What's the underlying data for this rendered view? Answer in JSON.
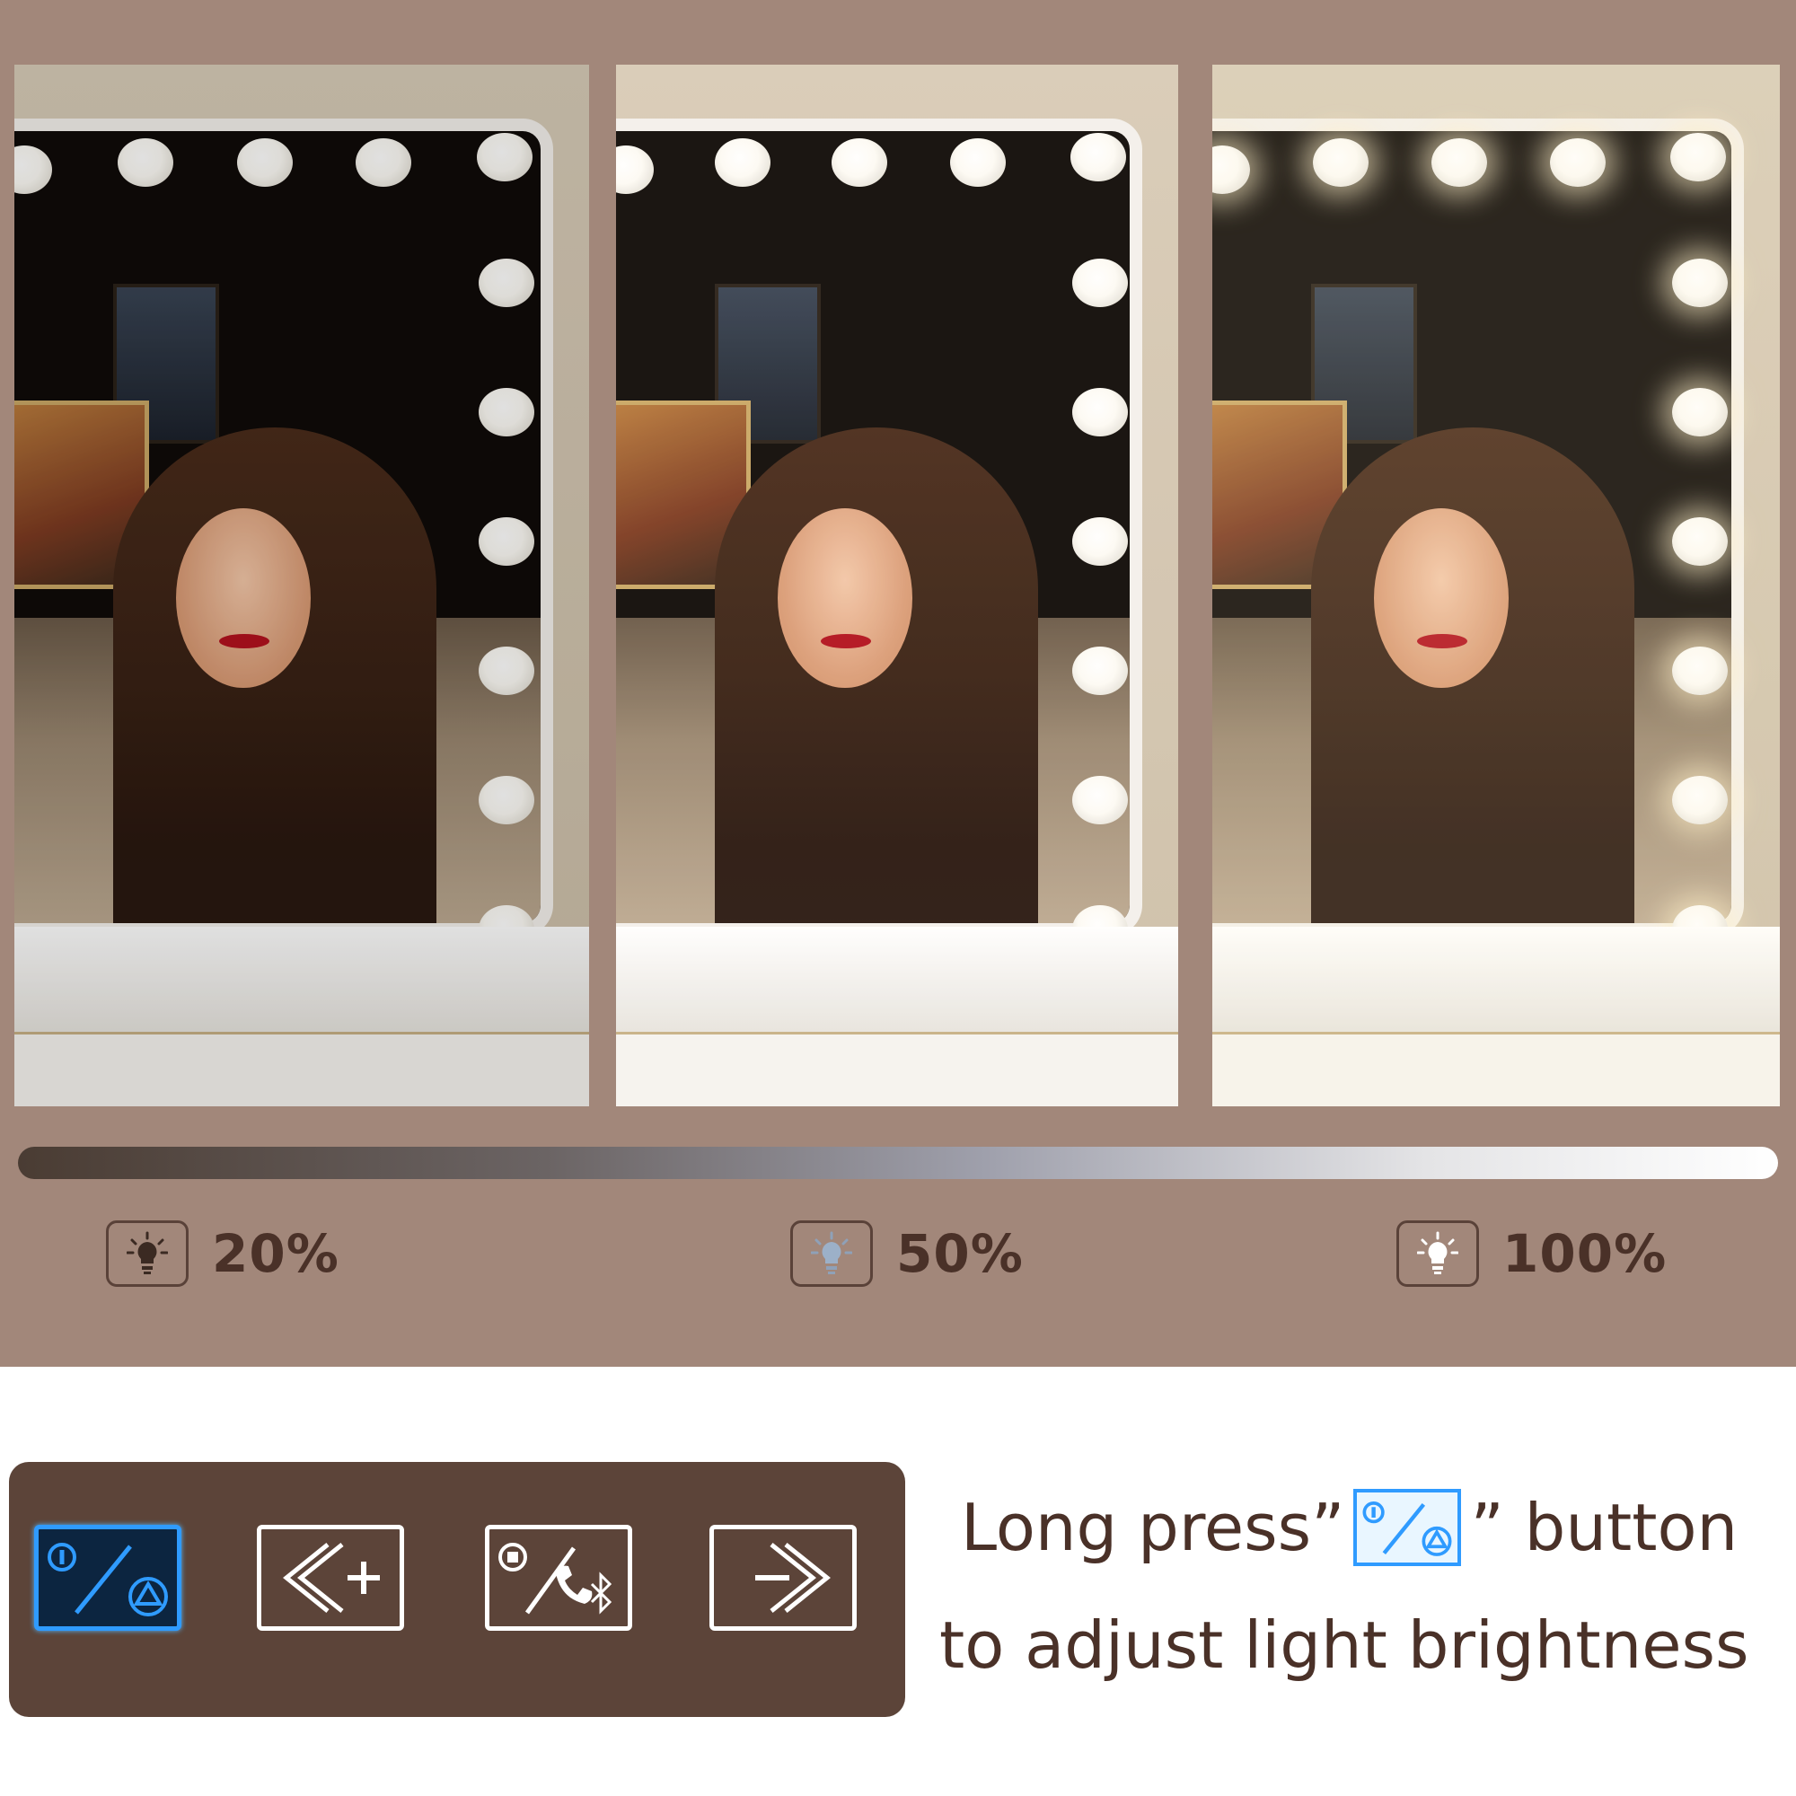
{
  "brightness_levels": [
    {
      "id": "low",
      "label": "20%",
      "value": 0.2,
      "icon": "lightbulb-dim-icon"
    },
    {
      "id": "mid",
      "label": "50%",
      "value": 0.5,
      "icon": "lightbulb-medium-icon"
    },
    {
      "id": "high",
      "label": "100%",
      "value": 1.0,
      "icon": "lightbulb-bright-icon"
    }
  ],
  "controls": [
    {
      "id": "power",
      "icon": "power-brightness-icon",
      "active": true
    },
    {
      "id": "previous-plus",
      "icon": "back-plus-icon",
      "active": false
    },
    {
      "id": "play-call-bluetooth",
      "icon": "play-call-bluetooth-icon",
      "active": false
    },
    {
      "id": "next",
      "icon": "forward-icon",
      "active": false
    }
  ],
  "instruction": {
    "line1_before": "Long press”",
    "line1_after": "” button",
    "line2": "to adjust light brightness",
    "button_icon": "power-brightness-icon"
  },
  "colors": {
    "background_top": "#a2877a",
    "controls_panel": "#5c4439",
    "text": "#4a3128",
    "accent_blue": "#2f9bff"
  }
}
